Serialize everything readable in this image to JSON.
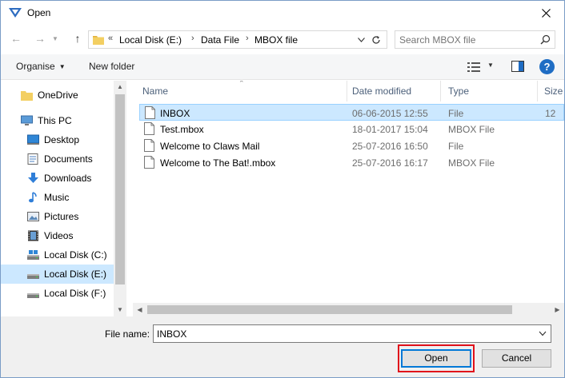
{
  "window": {
    "title": "Open"
  },
  "address": {
    "overflow": "«",
    "crumbs": [
      "Local Disk (E:)",
      "Data File",
      "MBOX file"
    ],
    "search_placeholder": "Search MBOX file"
  },
  "toolbar": {
    "organise": "Organise",
    "new_folder": "New folder"
  },
  "nav": {
    "items": [
      {
        "label": "OneDrive",
        "icon": "folder-icon"
      },
      {
        "label": "This PC",
        "icon": "computer-icon"
      },
      {
        "label": "Desktop",
        "icon": "desktop-icon"
      },
      {
        "label": "Documents",
        "icon": "documents-icon"
      },
      {
        "label": "Downloads",
        "icon": "download-icon"
      },
      {
        "label": "Music",
        "icon": "music-icon"
      },
      {
        "label": "Pictures",
        "icon": "pictures-icon"
      },
      {
        "label": "Videos",
        "icon": "videos-icon"
      },
      {
        "label": "Local Disk (C:)",
        "icon": "drive-icon"
      },
      {
        "label": "Local Disk (E:)",
        "icon": "drive-icon",
        "selected": true
      },
      {
        "label": "Local Disk (F:)",
        "icon": "drive-icon"
      }
    ]
  },
  "files": {
    "columns": [
      "Name",
      "Date modified",
      "Type",
      "Size"
    ],
    "rows": [
      {
        "name": "INBOX",
        "date": "06-06-2015 12:55",
        "type": "File",
        "size": "12",
        "selected": true
      },
      {
        "name": "Test.mbox",
        "date": "18-01-2017 15:04",
        "type": "MBOX File",
        "size": ""
      },
      {
        "name": "Welcome to Claws Mail",
        "date": "25-07-2016 16:50",
        "type": "File",
        "size": ""
      },
      {
        "name": "Welcome to The Bat!.mbox",
        "date": "25-07-2016 16:17",
        "type": "MBOX File",
        "size": ""
      }
    ]
  },
  "bottom": {
    "file_name_label": "File name:",
    "file_name_value": "INBOX",
    "open_label": "Open",
    "cancel_label": "Cancel"
  },
  "colors": {
    "selection": "#cce8ff",
    "accent": "#0078d7",
    "highlight_box": "#e0111b"
  }
}
